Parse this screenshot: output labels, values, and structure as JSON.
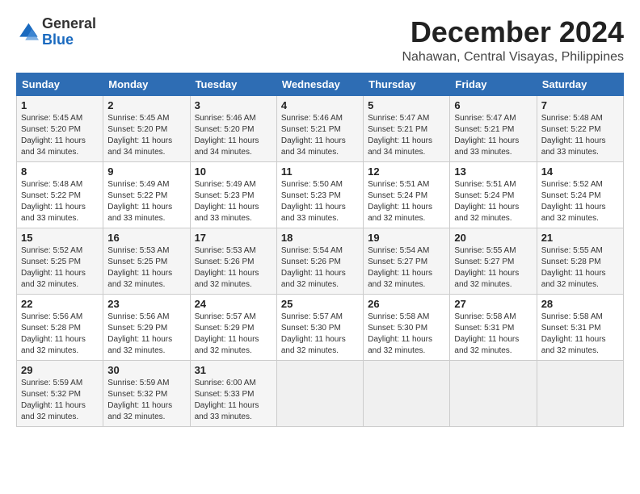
{
  "logo": {
    "general": "General",
    "blue": "Blue"
  },
  "header": {
    "month": "December 2024",
    "location": "Nahawan, Central Visayas, Philippines"
  },
  "weekdays": [
    "Sunday",
    "Monday",
    "Tuesday",
    "Wednesday",
    "Thursday",
    "Friday",
    "Saturday"
  ],
  "weeks": [
    [
      {
        "day": "1",
        "info": "Sunrise: 5:45 AM\nSunset: 5:20 PM\nDaylight: 11 hours\nand 34 minutes."
      },
      {
        "day": "2",
        "info": "Sunrise: 5:45 AM\nSunset: 5:20 PM\nDaylight: 11 hours\nand 34 minutes."
      },
      {
        "day": "3",
        "info": "Sunrise: 5:46 AM\nSunset: 5:20 PM\nDaylight: 11 hours\nand 34 minutes."
      },
      {
        "day": "4",
        "info": "Sunrise: 5:46 AM\nSunset: 5:21 PM\nDaylight: 11 hours\nand 34 minutes."
      },
      {
        "day": "5",
        "info": "Sunrise: 5:47 AM\nSunset: 5:21 PM\nDaylight: 11 hours\nand 34 minutes."
      },
      {
        "day": "6",
        "info": "Sunrise: 5:47 AM\nSunset: 5:21 PM\nDaylight: 11 hours\nand 33 minutes."
      },
      {
        "day": "7",
        "info": "Sunrise: 5:48 AM\nSunset: 5:22 PM\nDaylight: 11 hours\nand 33 minutes."
      }
    ],
    [
      {
        "day": "8",
        "info": "Sunrise: 5:48 AM\nSunset: 5:22 PM\nDaylight: 11 hours\nand 33 minutes."
      },
      {
        "day": "9",
        "info": "Sunrise: 5:49 AM\nSunset: 5:22 PM\nDaylight: 11 hours\nand 33 minutes."
      },
      {
        "day": "10",
        "info": "Sunrise: 5:49 AM\nSunset: 5:23 PM\nDaylight: 11 hours\nand 33 minutes."
      },
      {
        "day": "11",
        "info": "Sunrise: 5:50 AM\nSunset: 5:23 PM\nDaylight: 11 hours\nand 33 minutes."
      },
      {
        "day": "12",
        "info": "Sunrise: 5:51 AM\nSunset: 5:24 PM\nDaylight: 11 hours\nand 32 minutes."
      },
      {
        "day": "13",
        "info": "Sunrise: 5:51 AM\nSunset: 5:24 PM\nDaylight: 11 hours\nand 32 minutes."
      },
      {
        "day": "14",
        "info": "Sunrise: 5:52 AM\nSunset: 5:24 PM\nDaylight: 11 hours\nand 32 minutes."
      }
    ],
    [
      {
        "day": "15",
        "info": "Sunrise: 5:52 AM\nSunset: 5:25 PM\nDaylight: 11 hours\nand 32 minutes."
      },
      {
        "day": "16",
        "info": "Sunrise: 5:53 AM\nSunset: 5:25 PM\nDaylight: 11 hours\nand 32 minutes."
      },
      {
        "day": "17",
        "info": "Sunrise: 5:53 AM\nSunset: 5:26 PM\nDaylight: 11 hours\nand 32 minutes."
      },
      {
        "day": "18",
        "info": "Sunrise: 5:54 AM\nSunset: 5:26 PM\nDaylight: 11 hours\nand 32 minutes."
      },
      {
        "day": "19",
        "info": "Sunrise: 5:54 AM\nSunset: 5:27 PM\nDaylight: 11 hours\nand 32 minutes."
      },
      {
        "day": "20",
        "info": "Sunrise: 5:55 AM\nSunset: 5:27 PM\nDaylight: 11 hours\nand 32 minutes."
      },
      {
        "day": "21",
        "info": "Sunrise: 5:55 AM\nSunset: 5:28 PM\nDaylight: 11 hours\nand 32 minutes."
      }
    ],
    [
      {
        "day": "22",
        "info": "Sunrise: 5:56 AM\nSunset: 5:28 PM\nDaylight: 11 hours\nand 32 minutes."
      },
      {
        "day": "23",
        "info": "Sunrise: 5:56 AM\nSunset: 5:29 PM\nDaylight: 11 hours\nand 32 minutes."
      },
      {
        "day": "24",
        "info": "Sunrise: 5:57 AM\nSunset: 5:29 PM\nDaylight: 11 hours\nand 32 minutes."
      },
      {
        "day": "25",
        "info": "Sunrise: 5:57 AM\nSunset: 5:30 PM\nDaylight: 11 hours\nand 32 minutes."
      },
      {
        "day": "26",
        "info": "Sunrise: 5:58 AM\nSunset: 5:30 PM\nDaylight: 11 hours\nand 32 minutes."
      },
      {
        "day": "27",
        "info": "Sunrise: 5:58 AM\nSunset: 5:31 PM\nDaylight: 11 hours\nand 32 minutes."
      },
      {
        "day": "28",
        "info": "Sunrise: 5:58 AM\nSunset: 5:31 PM\nDaylight: 11 hours\nand 32 minutes."
      }
    ],
    [
      {
        "day": "29",
        "info": "Sunrise: 5:59 AM\nSunset: 5:32 PM\nDaylight: 11 hours\nand 32 minutes."
      },
      {
        "day": "30",
        "info": "Sunrise: 5:59 AM\nSunset: 5:32 PM\nDaylight: 11 hours\nand 32 minutes."
      },
      {
        "day": "31",
        "info": "Sunrise: 6:00 AM\nSunset: 5:33 PM\nDaylight: 11 hours\nand 33 minutes."
      },
      null,
      null,
      null,
      null
    ]
  ]
}
